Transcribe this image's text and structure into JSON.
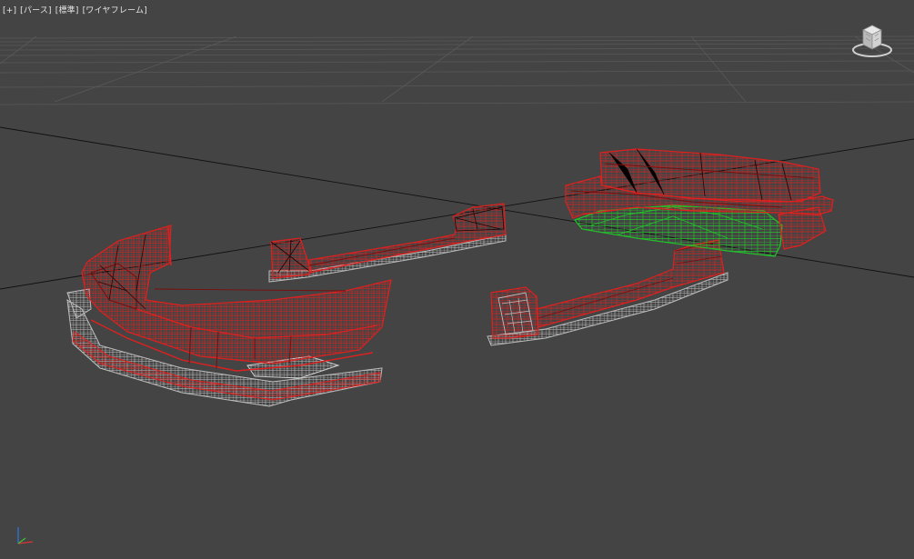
{
  "viewport": {
    "labels": [
      "[+]",
      "[パース]",
      "[標準]",
      "[ワイヤフレーム]"
    ]
  },
  "colors": {
    "background": "#444444",
    "grid": "#5a5a5a",
    "axis_line": "#111111",
    "wire_red": "#e0201e",
    "wire_red_dark": "#7a0d0c",
    "wire_gray": "#b8b8b8",
    "wire_green": "#22c22a",
    "wire_black": "#111111"
  },
  "icons": {
    "viewcube": "viewcube-icon",
    "axis_tripod": "axis-tripod-icon"
  },
  "objects": [
    "front-bumper-mesh",
    "side-skirt-left-mesh",
    "side-skirt-right-mesh",
    "rear-bumper-mesh"
  ]
}
